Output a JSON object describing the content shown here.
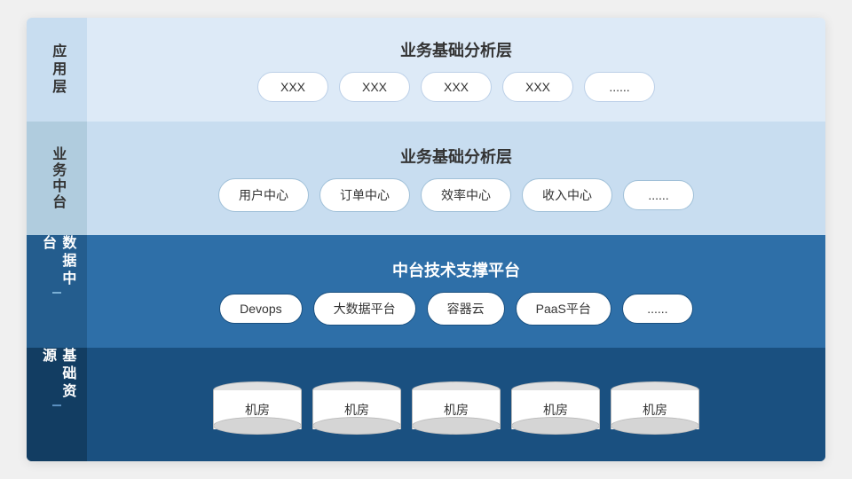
{
  "rows": [
    {
      "id": "app",
      "label": "应用层",
      "title": "业务基础分析层",
      "cards": [
        "XXX",
        "XXX",
        "XXX",
        "XXX",
        "......"
      ],
      "type": "cards"
    },
    {
      "id": "biz",
      "label": "业务中台",
      "title": "业务基础分析层",
      "cards": [
        "用户中心",
        "订单中心",
        "效率中心",
        "收入中心",
        "......"
      ],
      "type": "cards"
    },
    {
      "id": "data",
      "label": "数据中台",
      "title": "中台技术支撑平台",
      "cards": [
        "Devops",
        "大数据平台",
        "容器云",
        "PaaS平台",
        "......"
      ],
      "type": "cards",
      "has_ticks": true
    },
    {
      "id": "infra",
      "label": "基础资源",
      "title": "",
      "cylinders": [
        "机房",
        "机房",
        "机房",
        "机房",
        "机房"
      ],
      "type": "cylinders",
      "has_ticks": true
    }
  ]
}
